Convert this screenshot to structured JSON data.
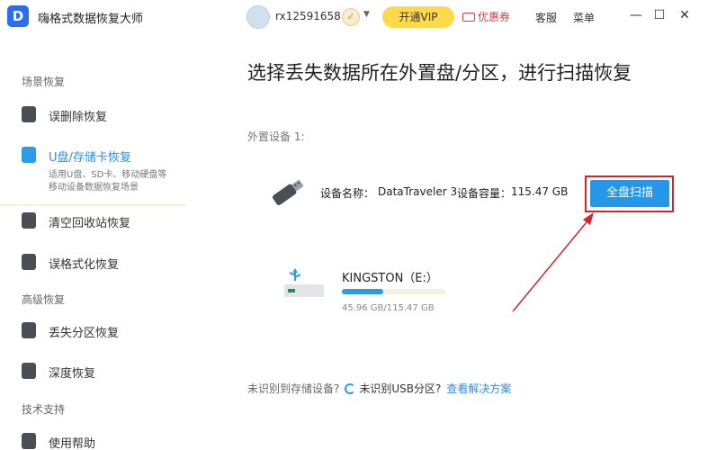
{
  "app": {
    "title": "嗨格式数据恢复大师",
    "logo_letter": "D"
  },
  "header": {
    "username": "rx12591658",
    "vip_button": "开通VIP",
    "coupon": "优惠券",
    "service": "客服",
    "menu": "菜单",
    "minimize": "—",
    "maximize": "☐",
    "close": "✕"
  },
  "sidebar": {
    "section_scene": "场景恢复",
    "section_advanced": "高级恢复",
    "section_support": "技术支持",
    "items": [
      {
        "label": "误删除恢复",
        "icon": "trash-restore-icon"
      },
      {
        "label": "U盘/存储卡恢复",
        "icon": "usb-drive-icon",
        "active": true,
        "desc_line1": "适用U盘、SD卡、移动硬盘等",
        "desc_line2": "移动设备数据恢复场景"
      },
      {
        "label": "清空回收站恢复",
        "icon": "recycle-bin-icon"
      },
      {
        "label": "误格式化恢复",
        "icon": "format-icon"
      },
      {
        "label": "丢失分区恢复",
        "icon": "partition-icon"
      },
      {
        "label": "深度恢复",
        "icon": "deep-scan-icon"
      },
      {
        "label": "使用帮助",
        "icon": "help-book-icon"
      }
    ]
  },
  "main": {
    "title": "选择丢失数据所在外置盘/分区，进行扫描恢复",
    "external_label": "外置设备 1:",
    "device": {
      "name_label": "设备名称：",
      "name_value": "DataTraveler 3",
      "capacity_label": "设备容量：",
      "capacity_value": "115.47 GB",
      "scan_button": "全盘扫描"
    },
    "drive": {
      "name": "KINGSTON（E:）",
      "size": "45.96 GB/115.47 GB",
      "usage_fraction": 0.398
    },
    "footer": {
      "prompt": "未识别到存储设备?",
      "unrecognized": "未识别USB分区?",
      "link": "查看解决方案"
    }
  },
  "colors": {
    "accent": "#2596e8",
    "vip": "#ffd94a",
    "highlight_frame": "#d82424"
  }
}
